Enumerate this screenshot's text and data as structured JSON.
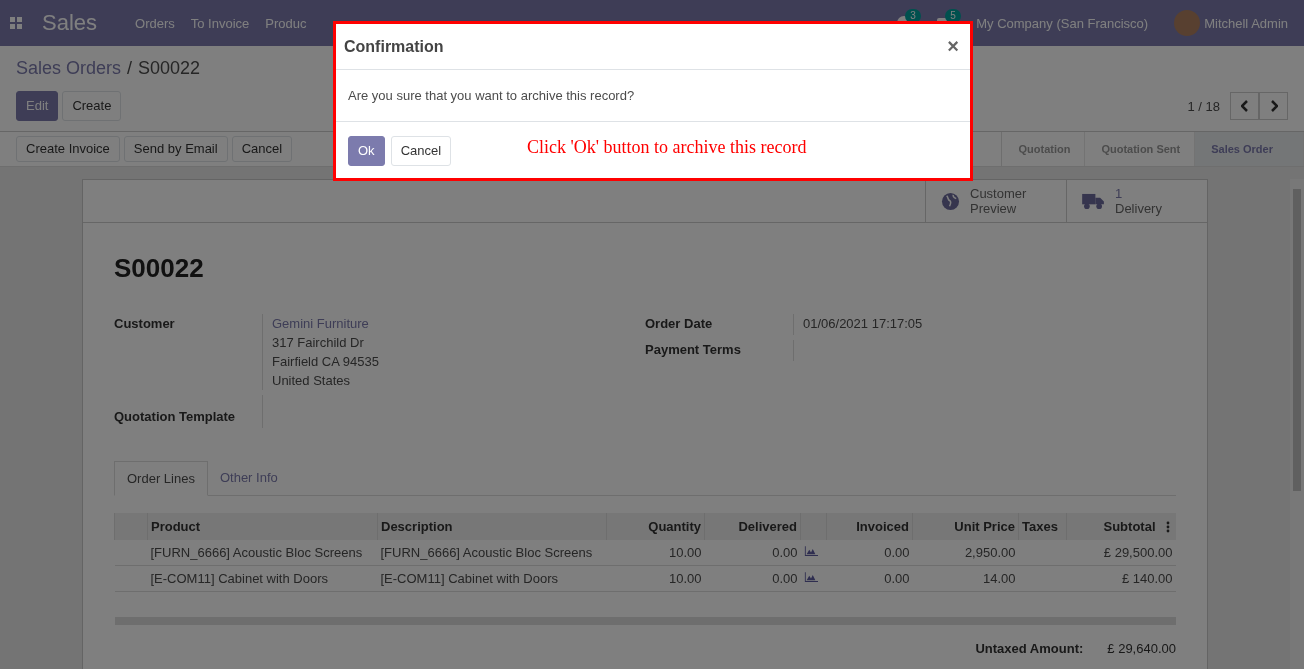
{
  "navbar": {
    "app_name": "Sales",
    "menu": [
      "Orders",
      "To Invoice",
      "Produc"
    ],
    "badges": [
      "3",
      "5"
    ],
    "company": "My Company (San Francisco)",
    "user": "Mitchell Admin"
  },
  "breadcrumb": {
    "items": [
      "Sales Orders",
      "S00022"
    ],
    "separator": "/"
  },
  "actions": [
    {
      "label": "Edit",
      "primary": true
    },
    {
      "label": "Create",
      "primary": false
    }
  ],
  "pager": "1 / 18",
  "header_buttons": [
    "Create Invoice",
    "Send by Email",
    "Cancel"
  ],
  "stages": [
    {
      "label": "Quotation",
      "selected": false
    },
    {
      "label": "Quotation Sent",
      "selected": false
    },
    {
      "label": "Sales Order",
      "selected": true
    }
  ],
  "smart_buttons": [
    {
      "kind": "globe",
      "lines": [
        "Customer",
        "Preview"
      ]
    },
    {
      "kind": "truck",
      "lines": [
        "1",
        "Delivery"
      ]
    }
  ],
  "form": {
    "title": "S00022",
    "left": [
      {
        "label": "Customer",
        "link": "Gemini Furniture",
        "lines": [
          "317 Fairchild Dr",
          "Fairfield CA 94535",
          "United States"
        ]
      },
      {
        "label": "Quotation Template"
      }
    ],
    "right": [
      {
        "label": "Order Date",
        "value": "01/06/2021 17:17:05"
      },
      {
        "label": "Payment Terms"
      }
    ]
  },
  "tabs": [
    {
      "label": "Order Lines",
      "selected": true
    },
    {
      "label": "Other Info",
      "selected": false
    }
  ],
  "table": {
    "columns": [
      "Product",
      "Description",
      "Quantity",
      "Delivered",
      "",
      "Invoiced",
      "Unit Price",
      "Taxes",
      "Subtotal"
    ],
    "rows": [
      [
        "[FURN_6666] Acoustic Bloc Screens",
        "[FURN_6666] Acoustic Bloc Screens",
        "10.00",
        "0.00",
        "",
        "0.00",
        "2,950.00",
        "",
        "£ 29,500.00"
      ],
      [
        "[E-COM11] Cabinet with Doors",
        "[E-COM11] Cabinet with Doors",
        "10.00",
        "0.00",
        "",
        "0.00",
        "14.00",
        "",
        "£ 140.00"
      ]
    ]
  },
  "totals": [
    {
      "label": "Untaxed Amount:",
      "value": "£ 29,640.00"
    }
  ],
  "dialog": {
    "title": "Confirmation",
    "close": "×",
    "message": "Are you sure that you want to archive this record?",
    "buttons": [
      {
        "label": "Ok",
        "primary": true
      },
      {
        "label": "Cancel",
        "primary": false
      }
    ],
    "annotation": "Click 'Ok' button to archive this record"
  }
}
